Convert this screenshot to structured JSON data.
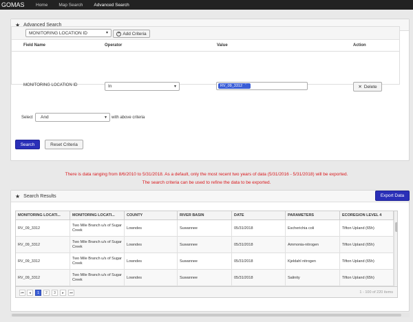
{
  "nav": {
    "brand": "GOMAS",
    "links": [
      "Home",
      "Map Search",
      "Advanced Search"
    ]
  },
  "advanced_search": {
    "title": "Advanced Search",
    "field_select": "MONITORING LOCATION ID",
    "add_criteria": "Add Criteria",
    "headers": {
      "field_name": "Field Name",
      "operator": "Operator",
      "value": "Value",
      "action": "Action"
    },
    "row": {
      "field": "MONITORING LOCATION ID",
      "operator": "In",
      "value_tag": "RV_09_3312",
      "delete": "Delete"
    },
    "select_label": "Select",
    "combine_value": "And",
    "combine_suffix": "with above criteria",
    "search_button": "Search",
    "reset_button": "Reset Criteria"
  },
  "notice": {
    "line1": "There is data ranging from 8/6/2010 to 5/31/2018. As a default, only the most recent two years of data (5/31/2016 - 5/31/2018) will be exported.",
    "line2": "The search criteria can be used to refine the data to be exported."
  },
  "results": {
    "title": "Search Results",
    "export_button": "Export Data",
    "columns": [
      "MONITORING LOCATI...",
      "MONITORING LOCATI...",
      "COUNTY",
      "RIVER BASIN",
      "DATE",
      "PARAMETERS",
      "ECOREGION LEVEL 4"
    ],
    "rows": [
      [
        "RV_09_3312",
        "Two Mile Branch u/s of Sugar Creek",
        "Lowndes",
        "Suwannee",
        "05/31/2018",
        "Escherichia coli",
        "Tifton Upland (65h)"
      ],
      [
        "RV_09_3312",
        "Two Mile Branch u/s of Sugar Creek",
        "Lowndes",
        "Suwannee",
        "05/31/2018",
        "Ammonia-nitrogen",
        "Tifton Upland (65h)"
      ],
      [
        "RV_09_3312",
        "Two Mile Branch u/s of Sugar Creek",
        "Lowndes",
        "Suwannee",
        "05/31/2018",
        "Kjeldahl nitrogen",
        "Tifton Upland (65h)"
      ],
      [
        "RV_09_3312",
        "Two Mile Branch u/s of Sugar Creek",
        "Lowndes",
        "Suwannee",
        "05/31/2018",
        "Salinity",
        "Tifton Upland (65h)"
      ]
    ],
    "pages": [
      "1",
      "2",
      "3"
    ],
    "current_page": "1",
    "page_info": "1 - 100 of 220 items"
  }
}
